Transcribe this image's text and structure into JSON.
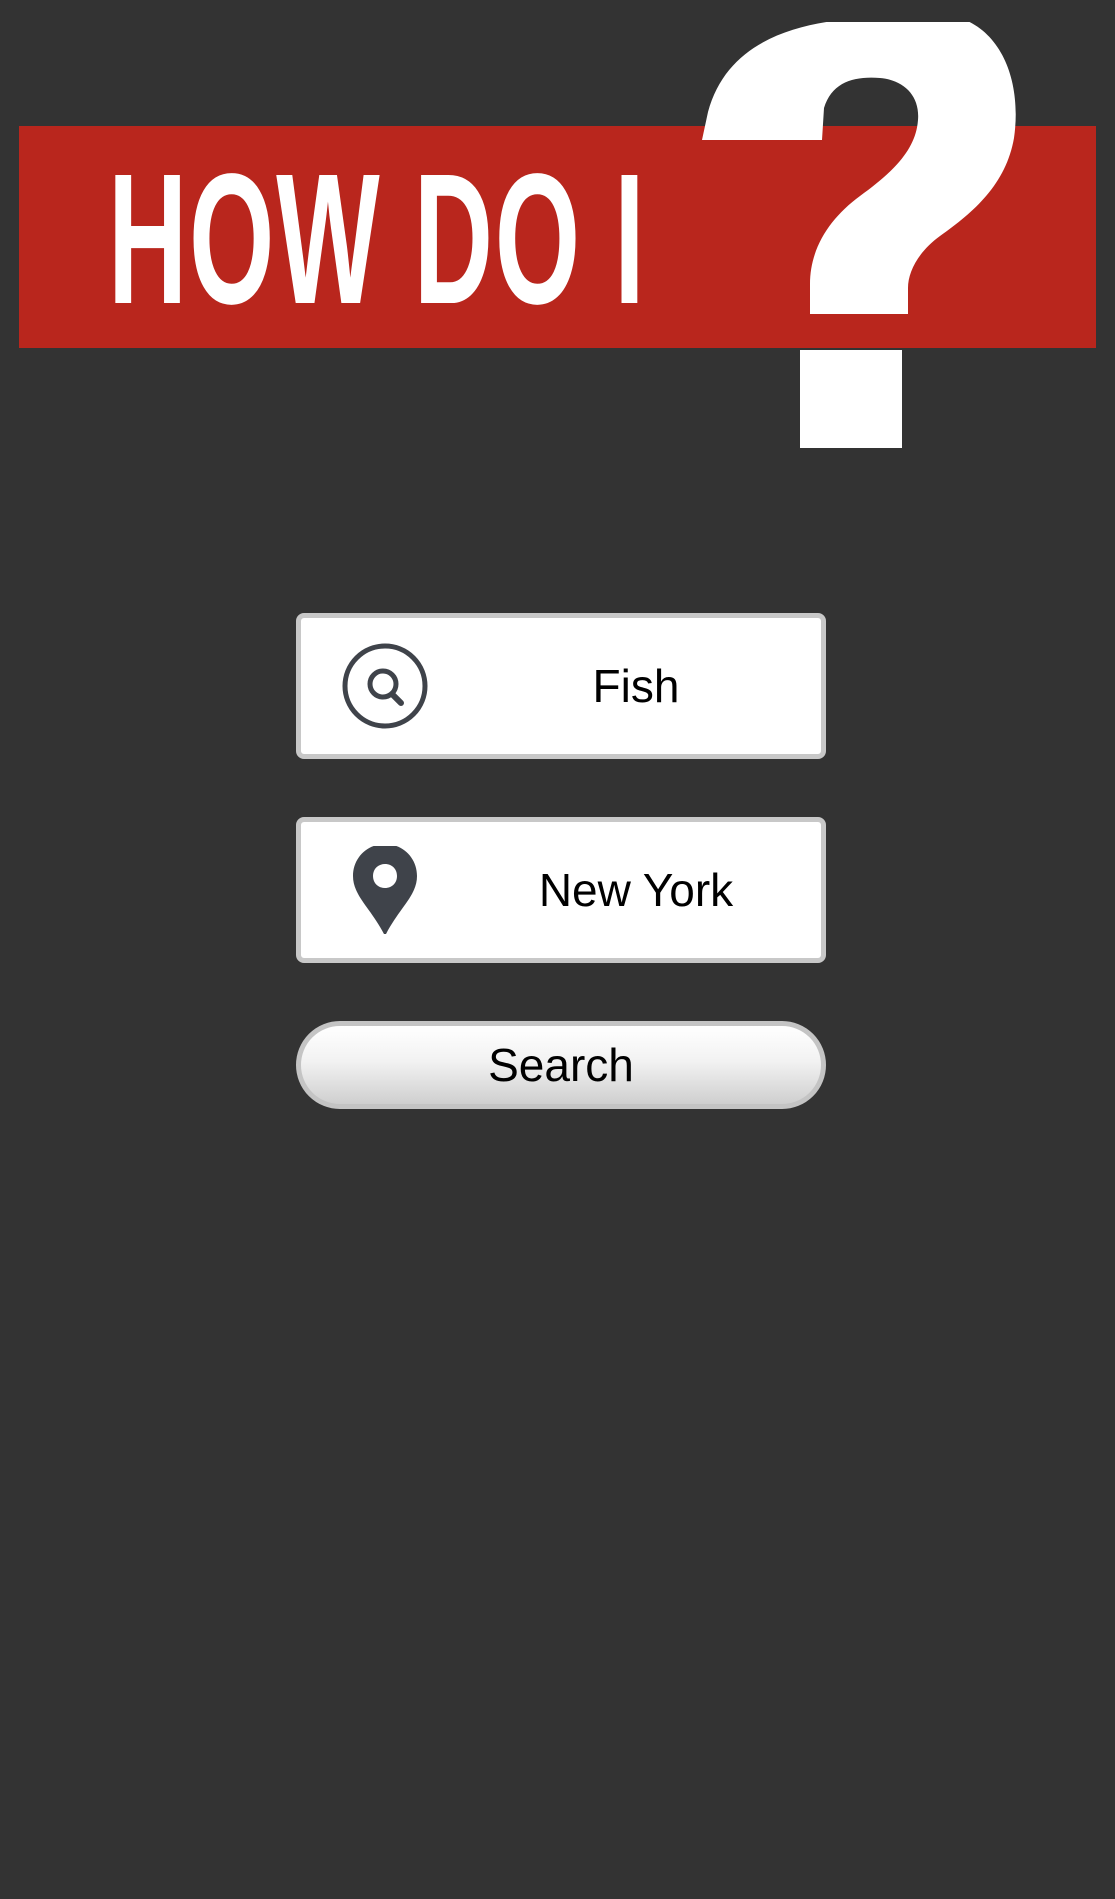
{
  "header": {
    "title": "HOW DO I",
    "logo_icon": "question-mark-icon",
    "banner_color": "#b9261d"
  },
  "form": {
    "query": {
      "icon": "search-icon",
      "value": "Fish"
    },
    "location": {
      "icon": "map-pin-icon",
      "value": "New York"
    },
    "submit_label": "Search"
  },
  "colors": {
    "background": "#333333",
    "field_border": "#c8c8c8",
    "icon": "#3f434a"
  }
}
